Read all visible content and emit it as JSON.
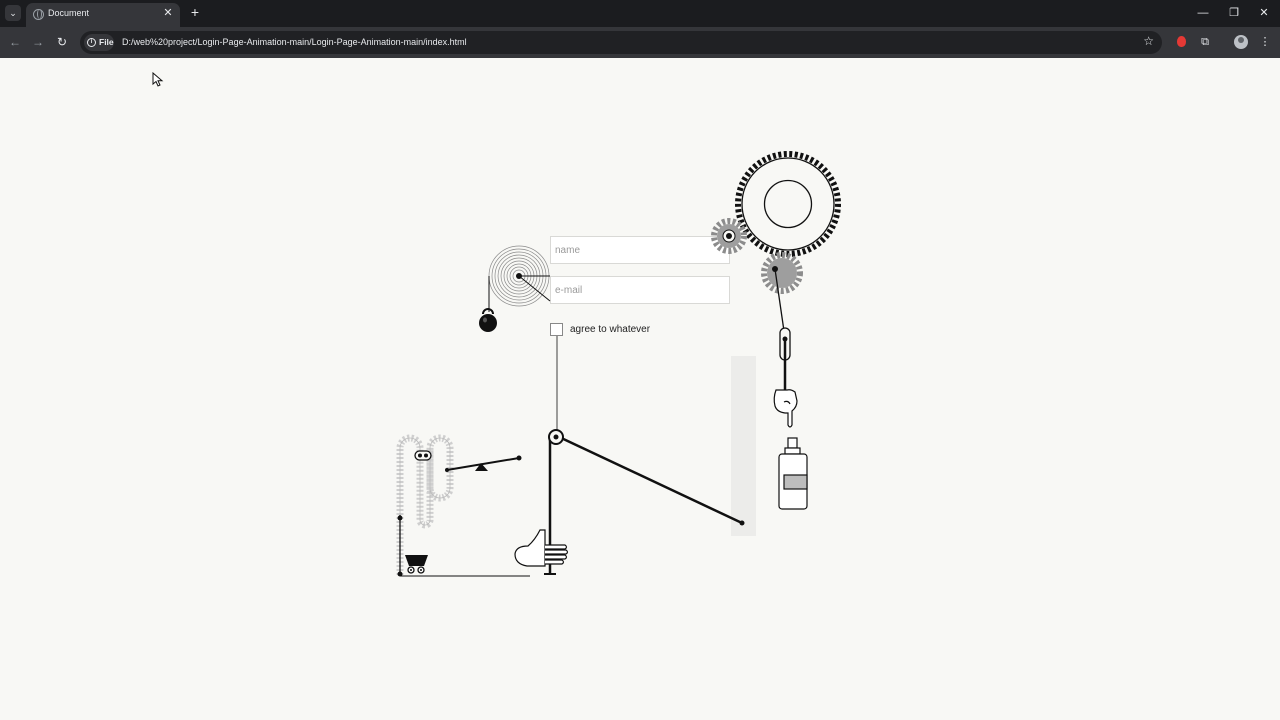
{
  "browser": {
    "tab_title": "Document",
    "tab_close": "✕",
    "new_tab": "+",
    "info_label": "File",
    "url": "D:/web%20project/Login-Page-Animation-main/Login-Page-Animation-main/index.html",
    "window_controls": {
      "minimize": "—",
      "restore": "❐",
      "close": "✕"
    },
    "nav": {
      "back": "←",
      "forward": "→",
      "reload": "↻"
    },
    "toolbar_icons": [
      "star-icon",
      "extension-red-icon",
      "extensions-puzzle-icon",
      "profile-avatar-icon",
      "kebab-menu-icon"
    ],
    "colors": {
      "chrome_dark": "#202124",
      "toolbar": "#35363a",
      "text": "#e8eaed"
    }
  },
  "form": {
    "name_placeholder": "name",
    "email_placeholder": "e-mail",
    "agree_label": "agree to whatever"
  },
  "illustration": {
    "icons": [
      "spiral-coil-icon",
      "kettlebell-icon",
      "large-gear-icon",
      "small-gear-icon",
      "medium-gear-icon",
      "pulley-icon",
      "pointing-hand-icon",
      "spray-bottle-icon",
      "lever-icon",
      "open-hand-icon",
      "conveyor-chain-icon",
      "cart-icon"
    ],
    "colors": {
      "ink": "#111111",
      "gear_fill": "#9e9e9e",
      "chain": "#cfcfcf",
      "page_bg": "#f8f8f5"
    }
  }
}
